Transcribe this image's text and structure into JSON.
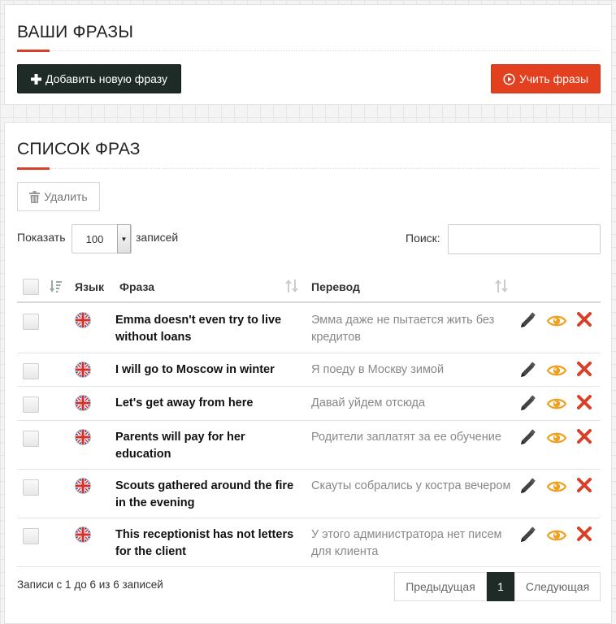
{
  "top": {
    "title": "ВАШИ ФРАЗЫ",
    "add_button": "Добавить новую фразу",
    "learn_button": "Учить фразы"
  },
  "list": {
    "title": "СПИСОК ФРАЗ",
    "delete_button": "Удалить",
    "show_label": "Показать",
    "page_size": "100",
    "records_label": "записей",
    "search_label": "Поиск:",
    "columns": {
      "language": "Язык",
      "phrase": "Фраза",
      "translation": "Перевод"
    },
    "rows": [
      {
        "language": "en-flag-icon",
        "phrase": "Emma doesn't even try to live without loans",
        "translation": "Эмма даже не пытается жить без кредитов"
      },
      {
        "language": "en-flag-icon",
        "phrase": "I will go to Moscow in winter",
        "translation": "Я поеду в Москву зимой"
      },
      {
        "language": "en-flag-icon",
        "phrase": "Let's get away from here",
        "translation": "Давай уйдем отсюда"
      },
      {
        "language": "en-flag-icon",
        "phrase": "Parents will pay for her education",
        "translation": "Родители заплатят за ее обучение"
      },
      {
        "language": "en-flag-icon",
        "phrase": "Scouts gathered around the fire in the evening",
        "translation": "Скауты собрались у костра вечером"
      },
      {
        "language": "en-flag-icon",
        "phrase": "This receptionist has not letters for the client",
        "translation": "У этого администратора нет писем для клиента"
      }
    ],
    "info": "Записи с 1 до 6 из 6 записей",
    "pagination": {
      "prev": "Предыдущая",
      "current": "1",
      "next": "Следующая"
    }
  },
  "colors": {
    "accent_red": "#e2401f",
    "dark": "#1f2b26",
    "view_orange": "#f0a020",
    "delete_red": "#d9402a"
  }
}
